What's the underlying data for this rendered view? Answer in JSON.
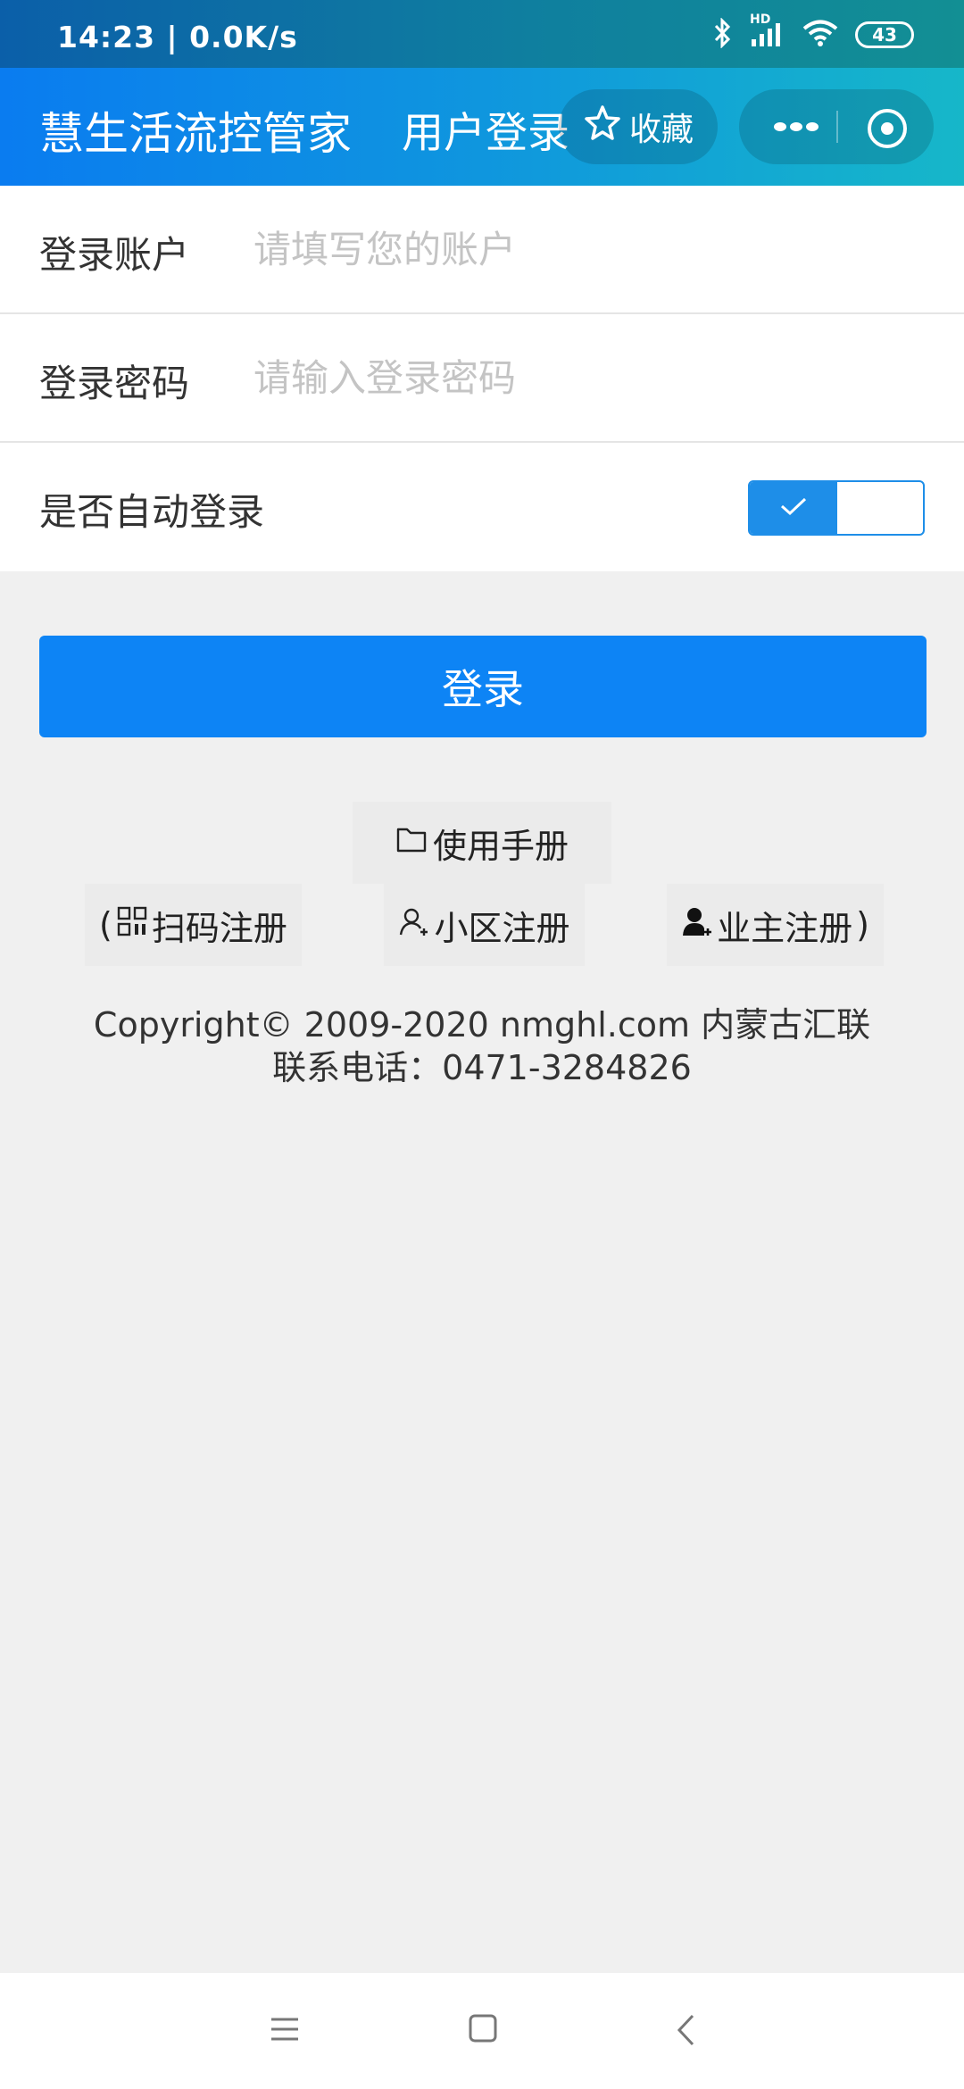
{
  "status": {
    "time_speed": "14:23 | 0.0K/s",
    "battery": "43",
    "hd_badge": "HD"
  },
  "header": {
    "app_title": "慧生活流控管家",
    "page_title": "用户登录",
    "favorite_label": "收藏"
  },
  "form": {
    "account_label": "登录账户",
    "account_placeholder": "请填写您的账户",
    "account_value": "",
    "password_label": "登录密码",
    "password_placeholder": "请输入登录密码",
    "password_value": "",
    "auto_login_label": "是否自动登录",
    "auto_login_on": true
  },
  "login_button": "登录",
  "manual_label": "使用手册",
  "register": {
    "open_paren": "(",
    "scan_label": "扫码注册",
    "community_label": "小区注册",
    "owner_label": "业主注册",
    "close_paren": ")"
  },
  "footer": {
    "copyright": "Copyright© 2009-2020 nmghl.com 内蒙古汇联",
    "phone": "联系电话：0471-3284826"
  },
  "colors": {
    "accent": "#0d84f5",
    "header_start": "#0a7cf0",
    "header_end": "#16b7c9",
    "toggle": "#1e8ee8"
  }
}
